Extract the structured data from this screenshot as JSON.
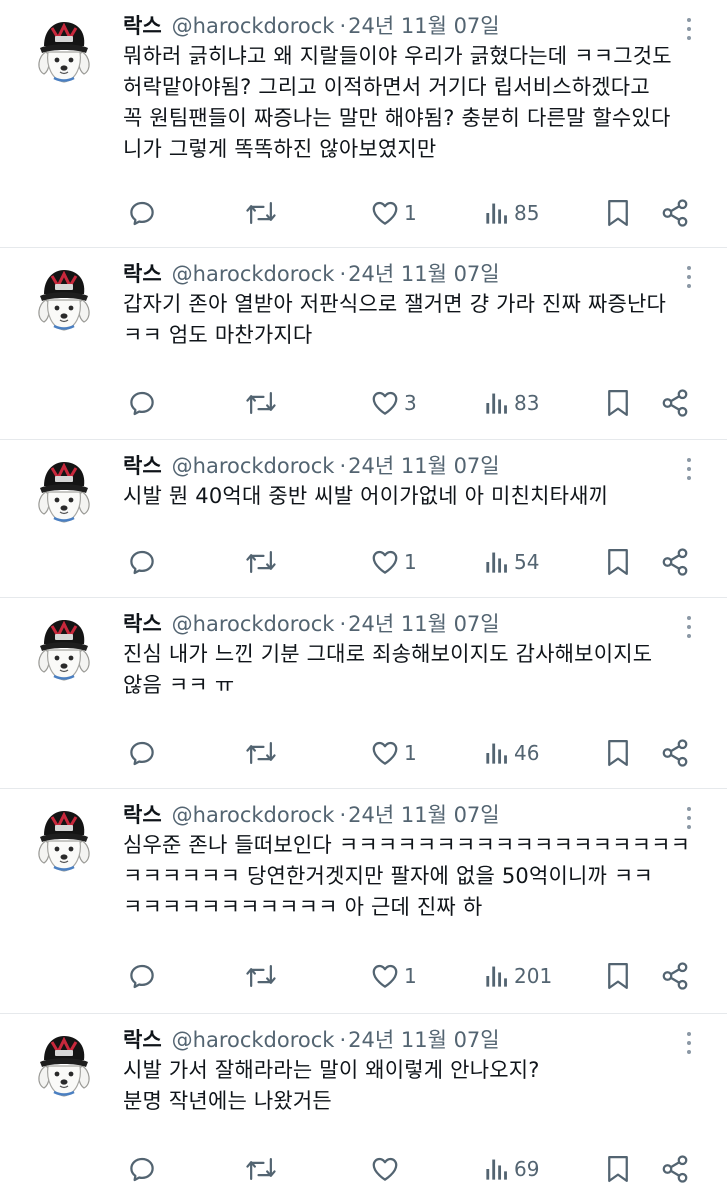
{
  "tweets": [
    {
      "name": "락스",
      "handle": "@harockdorock",
      "dot": "·",
      "date": "24년 11월 07일",
      "lines": [
        "뭐하러 긁히냐고 왜 지랄들이야 우리가 긁혔다는데 ㅋㅋ그것도",
        "허락맡아야됨? 그리고 이적하면서 거기다 립서비스하겠다고",
        "꼭 원팀팬들이 짜증나는 말만 해야됨? 충분히 다른말 할수있다",
        "니가 그렇게 똑똑하진 않아보였지만"
      ],
      "reply_count": "",
      "retweet_count": "",
      "likes": "1",
      "views": "85"
    },
    {
      "name": "락스",
      "handle": "@harockdorock",
      "dot": "·",
      "date": "24년 11월 07일",
      "lines": [
        "갑자기 존아 열받아 저판식으로 잴거면 걍 가라 진짜 짜증난다",
        "ㅋㅋ 엄도 마찬가지다"
      ],
      "likes": "3",
      "views": "83"
    },
    {
      "name": "락스",
      "handle": "@harockdorock",
      "dot": "·",
      "date": "24년 11월 07일",
      "lines": [
        "시발 뭔 40억대 중반 씨발 어이가없네 아 미친치타새끼"
      ],
      "likes": "1",
      "views": "54"
    },
    {
      "name": "락스",
      "handle": "@harockdorock",
      "dot": "·",
      "date": "24년 11월 07일",
      "lines": [
        "진심 내가 느낀 기분 그대로 죄송해보이지도 감사해보이지도",
        "않음 ㅋㅋ ㅠ"
      ],
      "likes": "1",
      "views": "46"
    },
    {
      "name": "락스",
      "handle": "@harockdorock",
      "dot": "·",
      "date": "24년 11월 07일",
      "lines": [
        "심우준 존나 들떠보인다 ㅋㅋㅋㅋㅋㅋㅋㅋㅋㅋㅋㅋㅋㅋㅋㅋㅋㅋ",
        "ㅋㅋㅋㅋㅋㅋ 당연한거겟지만 팔자에 없을 50억이니까 ㅋㅋ",
        "ㅋㅋㅋㅋㅋㅋㅋㅋㅋㅋㅋ 아 근데 진짜 하"
      ],
      "likes": "1",
      "views": "201"
    },
    {
      "name": "락스",
      "handle": "@harockdorock",
      "dot": "·",
      "date": "24년 11월 07일",
      "lines": [
        "시발 가서 잘해라라는 말이 왜이렇게 안나오지?",
        "분명 작년에는 나왔거든"
      ],
      "likes": "",
      "views": "69"
    }
  ],
  "icons": {
    "reply": "reply-icon",
    "retweet": "retweet-icon",
    "like": "heart-icon",
    "views": "views-icon",
    "bookmark": "bookmark-icon",
    "share": "share-icon",
    "more": "more-icon"
  },
  "colors": {
    "text": "#0f1419",
    "secondary": "#536471",
    "divider": "#e6e9ec"
  }
}
